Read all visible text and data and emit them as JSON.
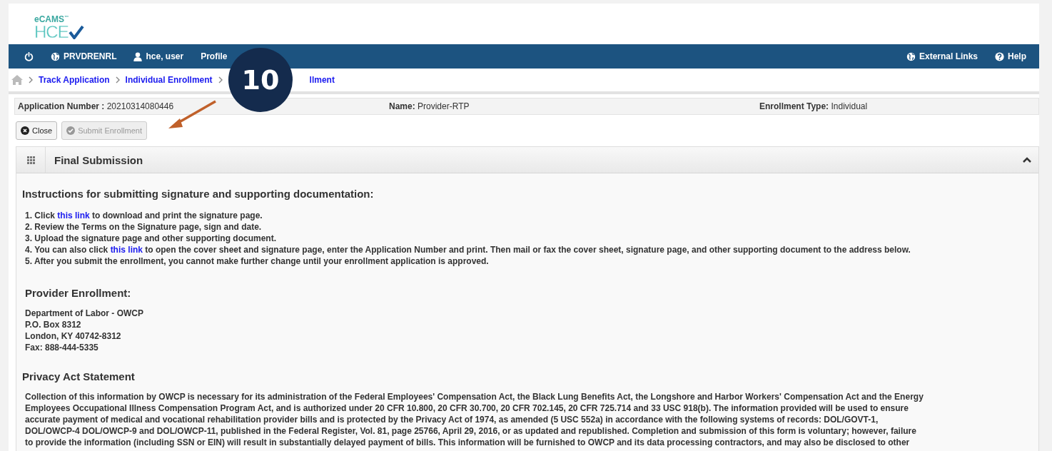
{
  "logo": {
    "top": "eCAMS",
    "bottom": "HCE",
    "trademark": "™"
  },
  "nav": {
    "left": [
      {
        "kind": "power"
      },
      {
        "kind": "globe",
        "label": "PRVDRENRL"
      },
      {
        "kind": "user",
        "label": "hce, user"
      },
      {
        "kind": "plain",
        "label": "Profile"
      }
    ],
    "right": [
      {
        "kind": "globe",
        "label": "External Links"
      },
      {
        "kind": "help",
        "label": "Help"
      }
    ]
  },
  "breadcrumbs": [
    {
      "kind": "home"
    },
    {
      "kind": "link",
      "label": "Track Application"
    },
    {
      "kind": "link",
      "label": "Individual Enrollment"
    },
    {
      "kind": "link",
      "label": "llment"
    }
  ],
  "annotation": {
    "badge": "10"
  },
  "info": [
    {
      "label": "Application Number :",
      "value": "20210314080446"
    },
    {
      "label": "Name:",
      "value": "Provider-RTP"
    },
    {
      "label": "Enrollment Type:",
      "value": "Individual"
    }
  ],
  "buttons": [
    {
      "label": "Close",
      "disabled": false
    },
    {
      "label": "Submit Enrollment",
      "disabled": true
    }
  ],
  "panel": {
    "title": "Final Submission",
    "expanded": true,
    "instructions_heading": "Instructions for submitting signature and supporting documentation:",
    "steps": [
      {
        "before": "1. Click ",
        "link": "this link",
        "after": " to download and print the signature page."
      },
      {
        "before": "2. Review the Terms on the Signature page, sign and date."
      },
      {
        "before": "3. Upload the signature page and other supporting document."
      },
      {
        "before": "4. You can also click ",
        "link": "this link",
        "after": " to open the cover sheet and signature page, enter the Application Number and print. Then mail or fax the cover sheet, signature page, and other supporting document to the address below."
      },
      {
        "before": "5. After you submit the enrollment, you cannot make further change until your enrollment application is approved."
      }
    ],
    "provider_heading": "Provider Enrollment:",
    "address": [
      "Department of Labor - OWCP",
      "P.O. Box 8312",
      "London, KY 40742-8312",
      "Fax: 888-444-5335"
    ],
    "privacy_heading": "Privacy Act Statement",
    "privacy_lines": [
      "Collection of this information by OWCP is necessary for its administration of the Federal Employees' Compensation Act, the Black Lung Benefits Act, the Longshore and Harbor Workers' Compensation Act and the Energy",
      "Employees Occupational Illness Compensation Program Act, and is authorized under 20 CFR 10.800, 20 CFR 30.700, 20 CFR 702.145, 20 CFR 725.714 and 33 USC 918(b). The information provided will be used to ensure",
      "accurate payment of medical and vocational rehabilitation provider bills and is protected by the Privacy Act of 1974, as amended (5 USC 552a) in accordance with the following systems of records: DOL/GOVT-1,",
      "DOL/OWCP-4 DOL/OWCP-9 and DOL/OWCP-11, published in the Federal Register, Vol. 81, page 25766, April 29, 2016, or as updated and republished. Completion and submission of this form is voluntary; however, failure",
      "to provide the information (including SSN or EIN) will result in substantially delayed payment of bills. This information will be furnished to OWCP and its data processing contractors, and may also be disclosed to other"
    ]
  }
}
